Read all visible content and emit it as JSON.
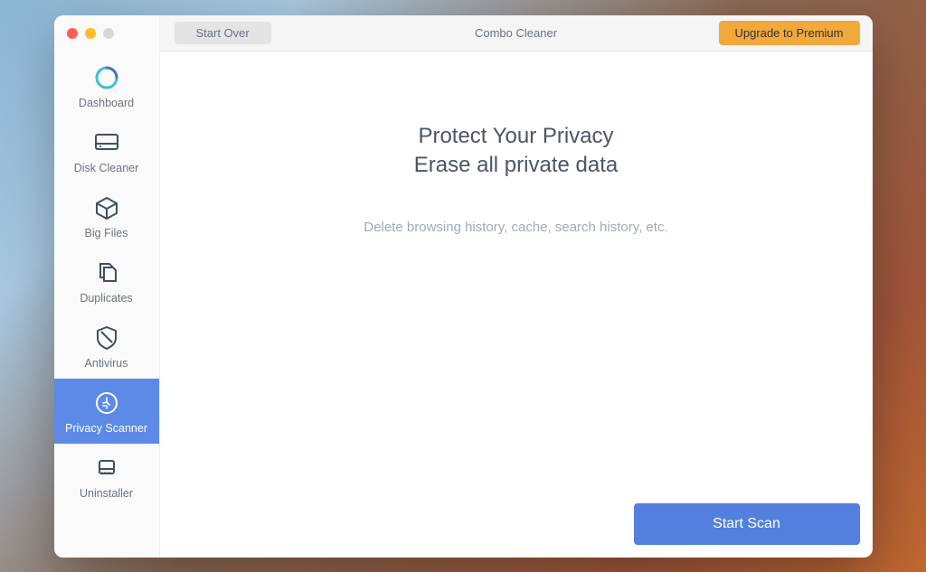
{
  "window": {
    "title": "Combo Cleaner"
  },
  "titlebar": {
    "start_over": "Start Over",
    "upgrade": "Upgrade to Premium"
  },
  "sidebar": {
    "items": [
      {
        "label": "Dashboard",
        "icon": "dashboard-icon",
        "active": false
      },
      {
        "label": "Disk Cleaner",
        "icon": "disk-icon",
        "active": false
      },
      {
        "label": "Big Files",
        "icon": "box-icon",
        "active": false
      },
      {
        "label": "Duplicates",
        "icon": "duplicates-icon",
        "active": false
      },
      {
        "label": "Antivirus",
        "icon": "shield-icon",
        "active": false
      },
      {
        "label": "Privacy Scanner",
        "icon": "privacy-icon",
        "active": true
      },
      {
        "label": "Uninstaller",
        "icon": "uninstaller-icon",
        "active": false
      }
    ]
  },
  "main": {
    "headline_line1": "Protect Your Privacy",
    "headline_line2": "Erase all private data",
    "subtext": "Delete browsing history, cache, search history, etc.",
    "start_scan": "Start Scan"
  }
}
